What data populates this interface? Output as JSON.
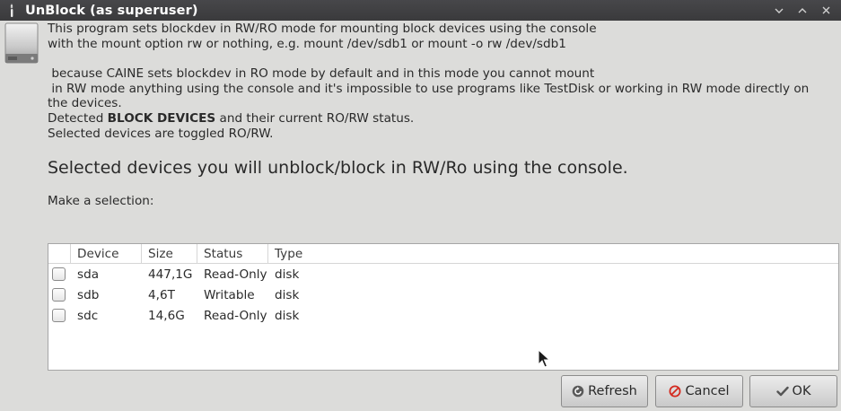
{
  "window": {
    "title": "UnBlock (as superuser)",
    "icons": {
      "app": "wand-icon",
      "minimize": "chevron-down-icon",
      "maximize": "chevron-up-icon",
      "close": "close-icon"
    }
  },
  "dialog_icon": "drive-icon",
  "description": {
    "line1": "This program sets blockdev in RW/RO mode for mounting block devices using the console",
    "line2": "with the mount option rw or nothing, e.g. mount /dev/sdb1 or mount -o rw /dev/sdb1",
    "line3": " because CAINE sets blockdev in RO mode by default and in this mode you cannot mount",
    "line4": " in RW mode anything using the console and it's impossible to use programs like TestDisk or working in RW mode directly on the devices.",
    "line5_prefix": "Detected ",
    "line5_bold": "BLOCK DEVICES",
    "line5_suffix": " and their current RO/RW status.",
    "line6": "Selected devices are toggled RO/RW."
  },
  "headline": "Selected devices you will unblock/block in RW/Ro using the console.",
  "prompt": "Make a selection:",
  "table": {
    "columns": [
      "",
      "Device",
      "Size",
      "Status",
      "Type"
    ],
    "rows": [
      {
        "checked": false,
        "device": "sda",
        "size": "447,1G",
        "status": "Read-Only",
        "type": "disk"
      },
      {
        "checked": false,
        "device": "sdb",
        "size": "4,6T",
        "status": "Writable",
        "type": "disk"
      },
      {
        "checked": false,
        "device": "sdc",
        "size": "14,6G",
        "status": "Read-Only",
        "type": "disk"
      }
    ]
  },
  "buttons": {
    "refresh": {
      "label": "Refresh",
      "icon": "refresh-icon"
    },
    "cancel": {
      "label": "Cancel",
      "icon": "cancel-icon"
    },
    "ok": {
      "label": "OK",
      "icon": "check-icon"
    }
  },
  "colors": {
    "titlebar": "#3f3f41",
    "background": "#dcdcda",
    "cancel_icon": "#d42a1f"
  }
}
